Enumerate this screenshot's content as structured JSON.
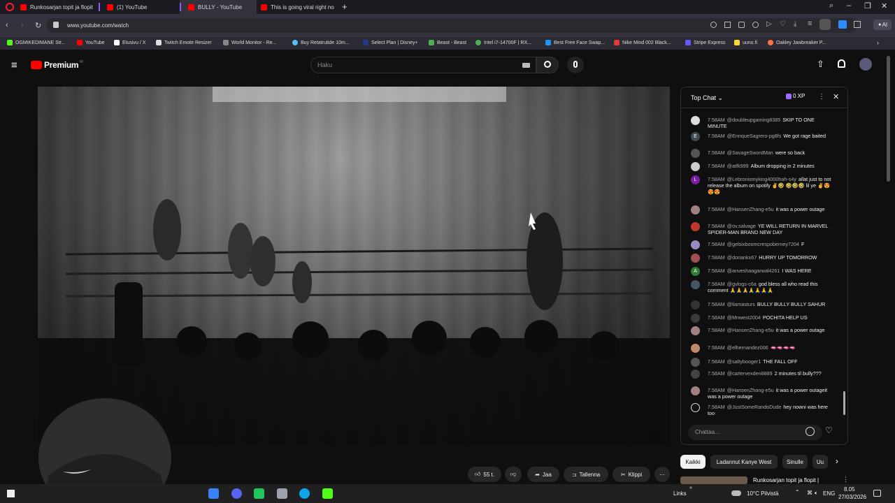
{
  "browser": {
    "tabs": [
      {
        "label": "Runkosarjan topit ja flopit",
        "color": "#ff0000"
      },
      {
        "label": "(1) YouTube",
        "color": "#ff0000"
      },
      {
        "label": "BULLY - YouTube",
        "color": "#ff0000"
      },
      {
        "label": "This is going viral right no",
        "color": "#ff0000"
      }
    ],
    "url": "www.youtube.com/watch",
    "bookmarks": [
      {
        "label": "OGMIKEDIMANE Str...",
        "color": "#53fc18"
      },
      {
        "label": "YouTube",
        "color": "#ff0000"
      },
      {
        "label": "Etusivu / X",
        "color": "#ffffff"
      },
      {
        "label": "Twitch Emote Resizer",
        "color": "#dddddd"
      },
      {
        "label": "World Monitor - Re...",
        "color": "#888888"
      },
      {
        "label": "Buy Retatrutide 10m...",
        "color": "#4fc3f7"
      },
      {
        "label": "Select Plan | Disney+",
        "color": "#1e3a8a"
      },
      {
        "label": "Beast - Beast",
        "color": "#4caf50"
      },
      {
        "label": "Intel i7-14700F | RX...",
        "color": "#4caf50"
      },
      {
        "label": "Best Free Face Swap...",
        "color": "#2196f3"
      },
      {
        "label": "Nike Mind 002 Black...",
        "color": "#e53935"
      },
      {
        "label": "Stripe Express",
        "color": "#635bff"
      },
      {
        "label": "uuno.fi",
        "color": "#fdd835"
      },
      {
        "label": "Oakley Jawbreaker P...",
        "color": "#ff7043"
      }
    ]
  },
  "youtube": {
    "logo_text": "Premium",
    "logo_sup": "FI",
    "search_placeholder": "Haku"
  },
  "actions": {
    "likes": "55 t.",
    "share": "Jaa",
    "save": "Tallenna",
    "clip": "Klippi"
  },
  "chat": {
    "mode": "Top Chat",
    "xp": "0 XP",
    "input_placeholder": "Chattaa...",
    "messages": [
      {
        "time": "7.58AM",
        "author": "@doubleupgaming8385",
        "text": "SKIP TO ONE MINUTE",
        "avatar": "",
        "color": "#dddddd"
      },
      {
        "time": "7.58AM",
        "author": "@EnriqueSagrero-pg8fs",
        "text": "We got rage baited",
        "avatar": "E",
        "color": "#3e4a52"
      },
      {
        "time": "7.58AM",
        "author": "@SavageSwordMan",
        "text": "were so back",
        "avatar": "",
        "color": "#555555"
      },
      {
        "time": "7.58AM",
        "author": "@atfk999",
        "text": "Album dropping in 2 minutes",
        "avatar": "",
        "color": "#cccccc"
      },
      {
        "time": "7.58AM",
        "author": "@Lebronismyking4000hah-s4y",
        "text": "allat just to not release the album on spotify ✌️🤣 🤣🤣🤣 lil ye ✌️😍😍😍",
        "avatar": "L",
        "color": "#7b1fa2"
      },
      {
        "time": "7.58AM",
        "author": "@HansenZhang-e5u",
        "text": "it was a power outage",
        "avatar": "",
        "color": "#a08080"
      },
      {
        "time": "7.58AM",
        "author": "@ov.salvage",
        "text": "YE WILL RETURN IN MARVEL SPIDER-MAN BRAND NEW DAY",
        "avatar": "",
        "color": "#c0392b"
      },
      {
        "time": "7.58AM",
        "author": "@gelsixboomcrespoberney7204",
        "text": "F",
        "avatar": "",
        "color": "#9a8cc0"
      },
      {
        "time": "7.58AM",
        "author": "@doriankx67",
        "text": "HURRY UP TOMORROW",
        "avatar": "",
        "color": "#a05050"
      },
      {
        "time": "7.58AM",
        "author": "@anveshaagarwal4261",
        "text": "I WAS HERE",
        "avatar": "A",
        "color": "#2e7d32"
      },
      {
        "time": "7.58AM",
        "author": "@gvlogs-c6a",
        "text": "god bless all who read this comment 🙏🙏🙏🙏🙏🙏🙏",
        "avatar": "",
        "color": "#445566"
      },
      {
        "time": "7.58AM",
        "author": "@liamasturs",
        "text": "BULLY BULLY BULLY SAHUR",
        "avatar": "",
        "color": "#333333"
      },
      {
        "time": "7.58AM",
        "author": "@Mnwest2004",
        "text": "POCHITA HELP US",
        "avatar": "",
        "color": "#3a3a3a"
      },
      {
        "time": "7.58AM",
        "author": "@HansenZhang-e5u",
        "text": "it was a power outage",
        "avatar": "",
        "color": "#a08080"
      },
      {
        "time": "7.58AM",
        "author": "@elhernandez006",
        "text": "🫦🫦🫦🫦",
        "avatar": "",
        "color": "#c08a6a"
      },
      {
        "time": "7.58AM",
        "author": "@saltybooger1",
        "text": "THE FALL OFF",
        "avatar": "",
        "color": "#555555"
      },
      {
        "time": "7.58AM",
        "author": "@cartervexden8889",
        "text": "2 minutes til bully???",
        "avatar": "",
        "color": "#444444"
      },
      {
        "time": "7.58AM",
        "author": "@HansenZhang-e5u",
        "text": "it was a power outageit was a power outage",
        "avatar": "",
        "color": "#a08080"
      },
      {
        "time": "7.58AM",
        "author": "@JustSomeRandoDude",
        "text": "hey nowni was here too",
        "avatar": "",
        "color": "#111111"
      }
    ]
  },
  "chips": [
    "Kaikki",
    "Ladannut Kanye West",
    "Sinulle",
    "Uu"
  ],
  "recommendation": {
    "title": "Runkosarjan topit ja flopit |"
  },
  "taskbar": {
    "links": "Links",
    "weather": "10°C Pilvistä",
    "lang": "ENG",
    "time": "8.05",
    "date": "27/03/2026"
  }
}
